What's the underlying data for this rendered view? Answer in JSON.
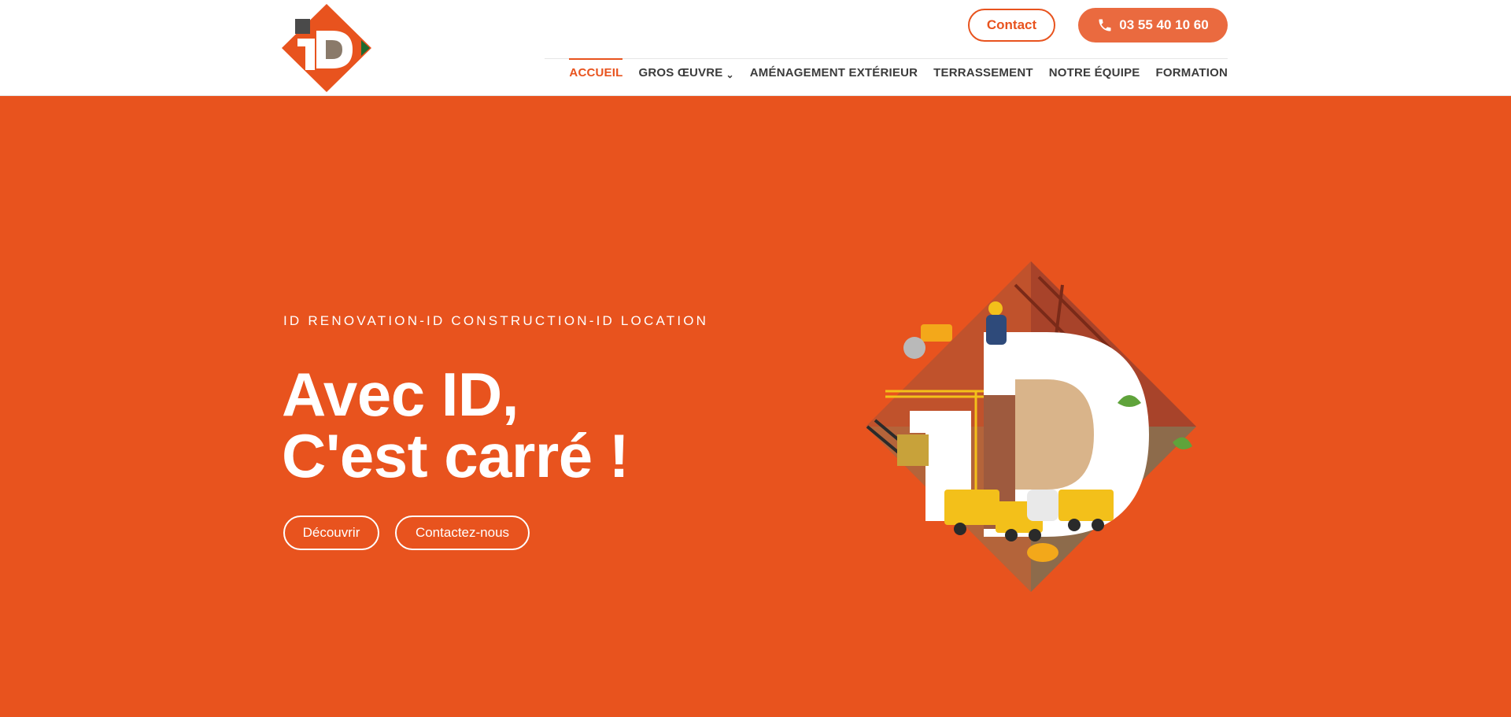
{
  "header": {
    "logo_text": "iD",
    "contact_label": "Contact",
    "phone_label": "03 55 40 10 60",
    "phone_icon": "phone-icon"
  },
  "nav": {
    "items": [
      {
        "label": "ACCUEIL",
        "active": true
      },
      {
        "label": "GROS ŒUVRE",
        "has_dropdown": true
      },
      {
        "label": "AMÉNAGEMENT EXTÉRIEUR"
      },
      {
        "label": "TERRASSEMENT"
      },
      {
        "label": "NOTRE ÉQUIPE"
      },
      {
        "label": "FORMATION"
      }
    ]
  },
  "hero": {
    "kicker": "ID RENOVATION-ID CONSTRUCTION-ID LOCATION",
    "headline_line1": "Avec ID,",
    "headline_line2": "C'est carré !",
    "cta_primary": "Découvrir",
    "cta_secondary": "Contactez-nous"
  },
  "colors": {
    "brand_orange": "#e8531e",
    "button_orange": "#ea6a3f",
    "nav_text": "#3b3b3b",
    "logo_green": "#1f6b2f",
    "logo_grey": "#4a4a4a",
    "logo_brown": "#8a7a6a"
  }
}
